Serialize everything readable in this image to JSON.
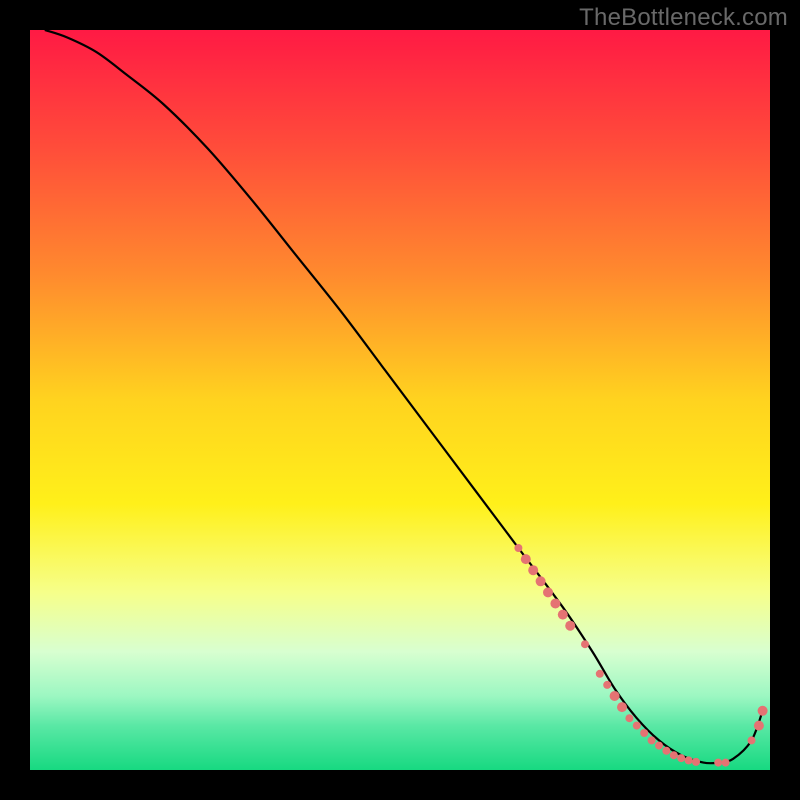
{
  "watermark": "TheBottleneck.com",
  "chart_data": {
    "type": "line",
    "title": "",
    "xlabel": "",
    "ylabel": "",
    "xlim": [
      0,
      100
    ],
    "ylim": [
      0,
      100
    ],
    "grid": false,
    "gradient_stops": [
      {
        "offset": 0.0,
        "color": "#ff1a44"
      },
      {
        "offset": 0.16,
        "color": "#ff4d3a"
      },
      {
        "offset": 0.33,
        "color": "#ff8a2e"
      },
      {
        "offset": 0.5,
        "color": "#ffd31f"
      },
      {
        "offset": 0.64,
        "color": "#fff01a"
      },
      {
        "offset": 0.76,
        "color": "#f6ff8a"
      },
      {
        "offset": 0.84,
        "color": "#d8ffd0"
      },
      {
        "offset": 0.9,
        "color": "#9cf7c2"
      },
      {
        "offset": 0.94,
        "color": "#5ae8a5"
      },
      {
        "offset": 1.0,
        "color": "#17d981"
      }
    ],
    "series": [
      {
        "name": "bottleneck-curve",
        "x": [
          2,
          5,
          9,
          13,
          18,
          24,
          30,
          36,
          42,
          48,
          54,
          60,
          66,
          72,
          76,
          79,
          82,
          85,
          88,
          91,
          93,
          95,
          97.5,
          99
        ],
        "y": [
          100,
          99,
          97,
          94,
          90,
          84,
          77,
          69.5,
          62,
          54,
          46,
          38,
          30,
          22,
          16,
          11,
          7,
          4,
          2,
          1,
          1,
          1.5,
          4,
          8
        ]
      }
    ],
    "markers": {
      "name": "highlight-points",
      "color": "#e57373",
      "x": [
        66,
        67,
        68,
        69,
        70,
        71,
        72,
        73,
        75,
        77,
        78,
        79,
        80,
        81,
        82,
        83,
        84,
        85,
        86,
        87,
        88,
        89,
        90,
        93,
        94,
        97.5,
        98.5,
        99
      ],
      "y": [
        30,
        28.5,
        27,
        25.5,
        24,
        22.5,
        21,
        19.5,
        17,
        13,
        11.5,
        10,
        8.5,
        7,
        6,
        5,
        4,
        3.3,
        2.6,
        2,
        1.6,
        1.3,
        1.1,
        1,
        1,
        4,
        6,
        8
      ],
      "r": [
        4,
        5,
        5,
        5,
        5,
        5,
        5,
        5,
        4,
        4,
        4,
        5,
        5,
        4,
        4,
        4,
        4,
        4,
        4,
        4,
        4,
        4,
        4,
        4,
        4,
        4,
        5,
        5
      ]
    }
  }
}
